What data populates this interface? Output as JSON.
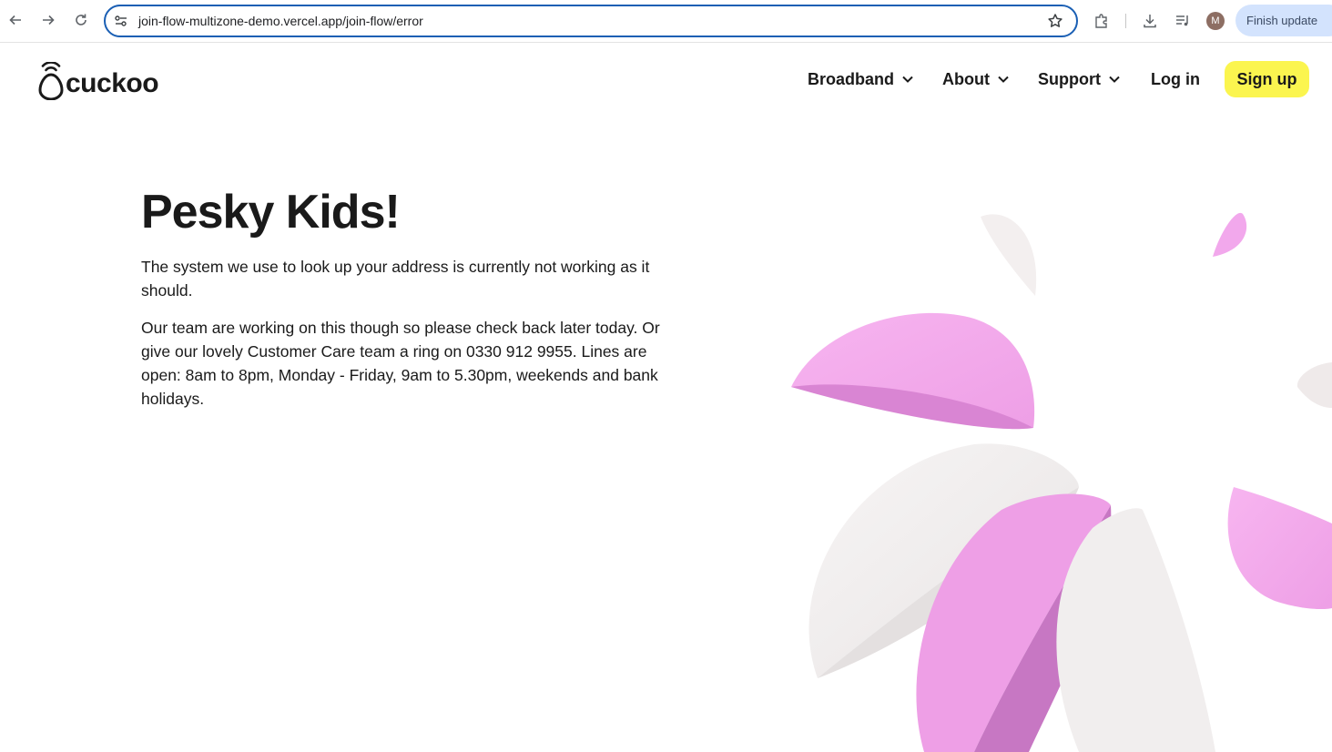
{
  "browser": {
    "url": "join-flow-multizone-demo.vercel.app/join-flow/error",
    "profile_initial": "M",
    "update_label": "Finish update",
    "icons": [
      "back-arrow-icon",
      "forward-arrow-icon",
      "reload-icon",
      "site-settings-icon",
      "bookmark-star-icon",
      "extensions-icon",
      "download-icon",
      "media-controls-icon"
    ]
  },
  "site": {
    "logo_text": "cuckoo",
    "nav": {
      "broadband": "Broadband",
      "about": "About",
      "support": "Support",
      "login": "Log in",
      "signup": "Sign up"
    },
    "accent_color": "#fbf54f"
  },
  "content": {
    "heading": "Pesky Kids!",
    "paragraph1": "The system we use to look up your address is currently not working as it should.",
    "paragraph2": "Our team are working on this though so please check back later today. Or give our lovely Customer Care team a ring on 0330 912 9955. Lines are open: 8am to 8pm, Monday - Friday, 9am to 5.30pm, weekends and bank holidays."
  },
  "decoration": {
    "petal_pink": "#f5b0ef",
    "petal_dark_pink": "#c978c4",
    "petal_white": "#f2efef"
  }
}
